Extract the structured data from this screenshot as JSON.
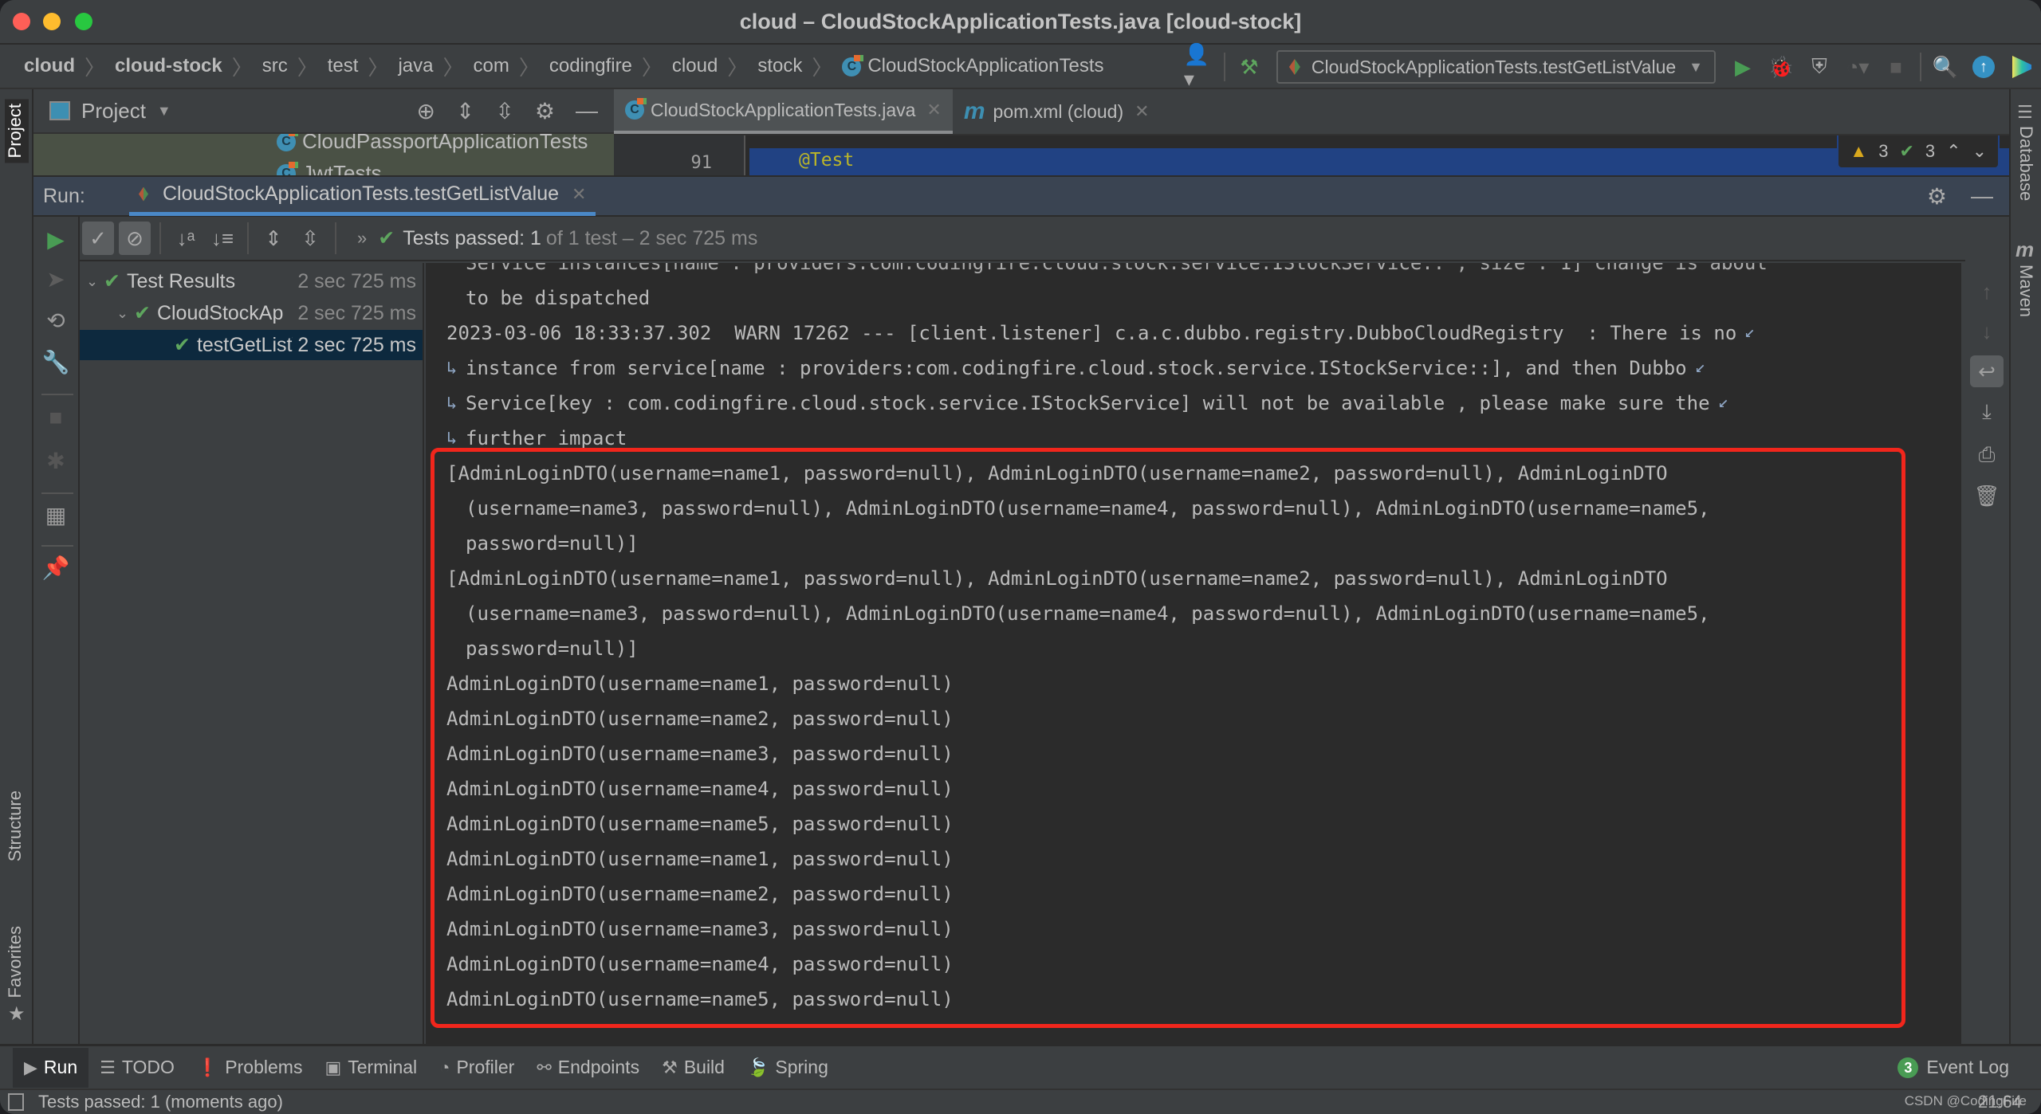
{
  "window": {
    "title": "cloud – CloudStockApplicationTests.java [cloud-stock]"
  },
  "breadcrumb": [
    {
      "label": "cloud",
      "bold": true
    },
    {
      "label": "cloud-stock",
      "bold": true
    },
    {
      "label": "src"
    },
    {
      "label": "test"
    },
    {
      "label": "java"
    },
    {
      "label": "com"
    },
    {
      "label": "codingfire"
    },
    {
      "label": "cloud"
    },
    {
      "label": "stock"
    },
    {
      "label": "CloudStockApplicationTests",
      "icon": "class-icon"
    }
  ],
  "toolbar": {
    "run_config": "CloudStockApplicationTests.testGetListValue",
    "icons": [
      "user-icon",
      "build-hammer-icon",
      "run-icon",
      "debug-icon",
      "coverage-icon",
      "profile-icon",
      "stop-icon",
      "search-icon",
      "update-icon",
      "jetbrains-logo-icon"
    ]
  },
  "project_panel": {
    "title": "Project",
    "tree_items": [
      "CloudPassportApplicationTests",
      "JwtTests"
    ]
  },
  "editor": {
    "tabs": [
      {
        "label": "CloudStockApplicationTests.java",
        "active": true,
        "icon": "class-icon"
      },
      {
        "label": "pom.xml (cloud)",
        "active": false,
        "icon": "maven-m-icon"
      }
    ],
    "visible_line_number": "91",
    "visible_code": "@Test",
    "warnings_count": "3",
    "weak_warnings_count": "3"
  },
  "left_stripe": {
    "project_label": "Project",
    "structure_label": "Structure",
    "favorites_label": "Favorites"
  },
  "right_stripe": {
    "database_label": "Database",
    "maven_label": "Maven"
  },
  "run_panel": {
    "run_label": "Run:",
    "tab_label": "CloudStockApplicationTests.testGetListValue",
    "status_passed": "Tests passed: 1",
    "status_detail": "of 1 test – 2 sec 725 ms",
    "tree": [
      {
        "label": "Test Results",
        "time": "2 sec 725 ms",
        "level": 0,
        "expanded": true
      },
      {
        "label": "CloudStockApplicationTests",
        "time": "2 sec 725 ms",
        "level": 1,
        "expanded": true
      },
      {
        "label": "testGetListValue",
        "time": "2 sec 725 ms",
        "level": 2,
        "selected": true
      }
    ]
  },
  "console": {
    "lines": [
      {
        "text": "Service instances[name : providers:com.codingfire.cloud.stock.service.IStockService:: , size : 1] change is about",
        "indent": true,
        "clipped": true
      },
      {
        "text": "to be dispatched",
        "indent": true
      },
      {
        "text": "2023-03-06 18:33:37.302  WARN 17262 --- [client.listener] c.a.c.dubbo.registry.DubboCloudRegistry  : There is no",
        "wrap": true
      },
      {
        "text": "instance from service[name : providers:com.codingfire.cloud.stock.service.IStockService::], and then Dubbo",
        "indent": true,
        "wrap": true,
        "wrapped_from": true
      },
      {
        "text": "Service[key : com.codingfire.cloud.stock.service.IStockService] will not be available , please make sure the",
        "indent": true,
        "wrap": true,
        "wrapped_from": true
      },
      {
        "text": "further impact",
        "indent": true,
        "wrapped_from": true
      },
      {
        "text": "[AdminLoginDTO(username=name1, password=null), AdminLoginDTO(username=name2, password=null), AdminLoginDTO"
      },
      {
        "text": "(username=name3, password=null), AdminLoginDTO(username=name4, password=null), AdminLoginDTO(username=name5,",
        "indent": true
      },
      {
        "text": "password=null)]",
        "indent": true
      },
      {
        "text": "[AdminLoginDTO(username=name1, password=null), AdminLoginDTO(username=name2, password=null), AdminLoginDTO"
      },
      {
        "text": "(username=name3, password=null), AdminLoginDTO(username=name4, password=null), AdminLoginDTO(username=name5,",
        "indent": true
      },
      {
        "text": "password=null)]",
        "indent": true
      },
      {
        "text": "AdminLoginDTO(username=name1, password=null)"
      },
      {
        "text": "AdminLoginDTO(username=name2, password=null)"
      },
      {
        "text": "AdminLoginDTO(username=name3, password=null)"
      },
      {
        "text": "AdminLoginDTO(username=name4, password=null)"
      },
      {
        "text": "AdminLoginDTO(username=name5, password=null)"
      },
      {
        "text": "AdminLoginDTO(username=name1, password=null)"
      },
      {
        "text": "AdminLoginDTO(username=name2, password=null)"
      },
      {
        "text": "AdminLoginDTO(username=name3, password=null)"
      },
      {
        "text": "AdminLoginDTO(username=name4, password=null)"
      },
      {
        "text": "AdminLoginDTO(username=name5, password=null)"
      }
    ],
    "highlight_color": "#f1261c"
  },
  "bottom_tools": [
    {
      "label": "Run",
      "icon": "run-icon",
      "active": true
    },
    {
      "label": "TODO",
      "icon": "list-icon"
    },
    {
      "label": "Problems",
      "icon": "problems-icon"
    },
    {
      "label": "Terminal",
      "icon": "terminal-icon"
    },
    {
      "label": "Profiler",
      "icon": "profiler-icon"
    },
    {
      "label": "Endpoints",
      "icon": "endpoints-icon"
    },
    {
      "label": "Build",
      "icon": "build-hammer-icon"
    },
    {
      "label": "Spring",
      "icon": "spring-leaf-icon"
    }
  ],
  "event_log": {
    "label": "Event Log",
    "count": "3"
  },
  "statusbar": {
    "text": "Tests passed: 1 (moments ago)",
    "position": "21:64",
    "watermark": "CSDN @CodingFire"
  },
  "colors": {
    "accent": "#4a88c7",
    "success": "#5ea65e",
    "warning": "#d9a81d",
    "highlight_box": "#f1261c"
  }
}
